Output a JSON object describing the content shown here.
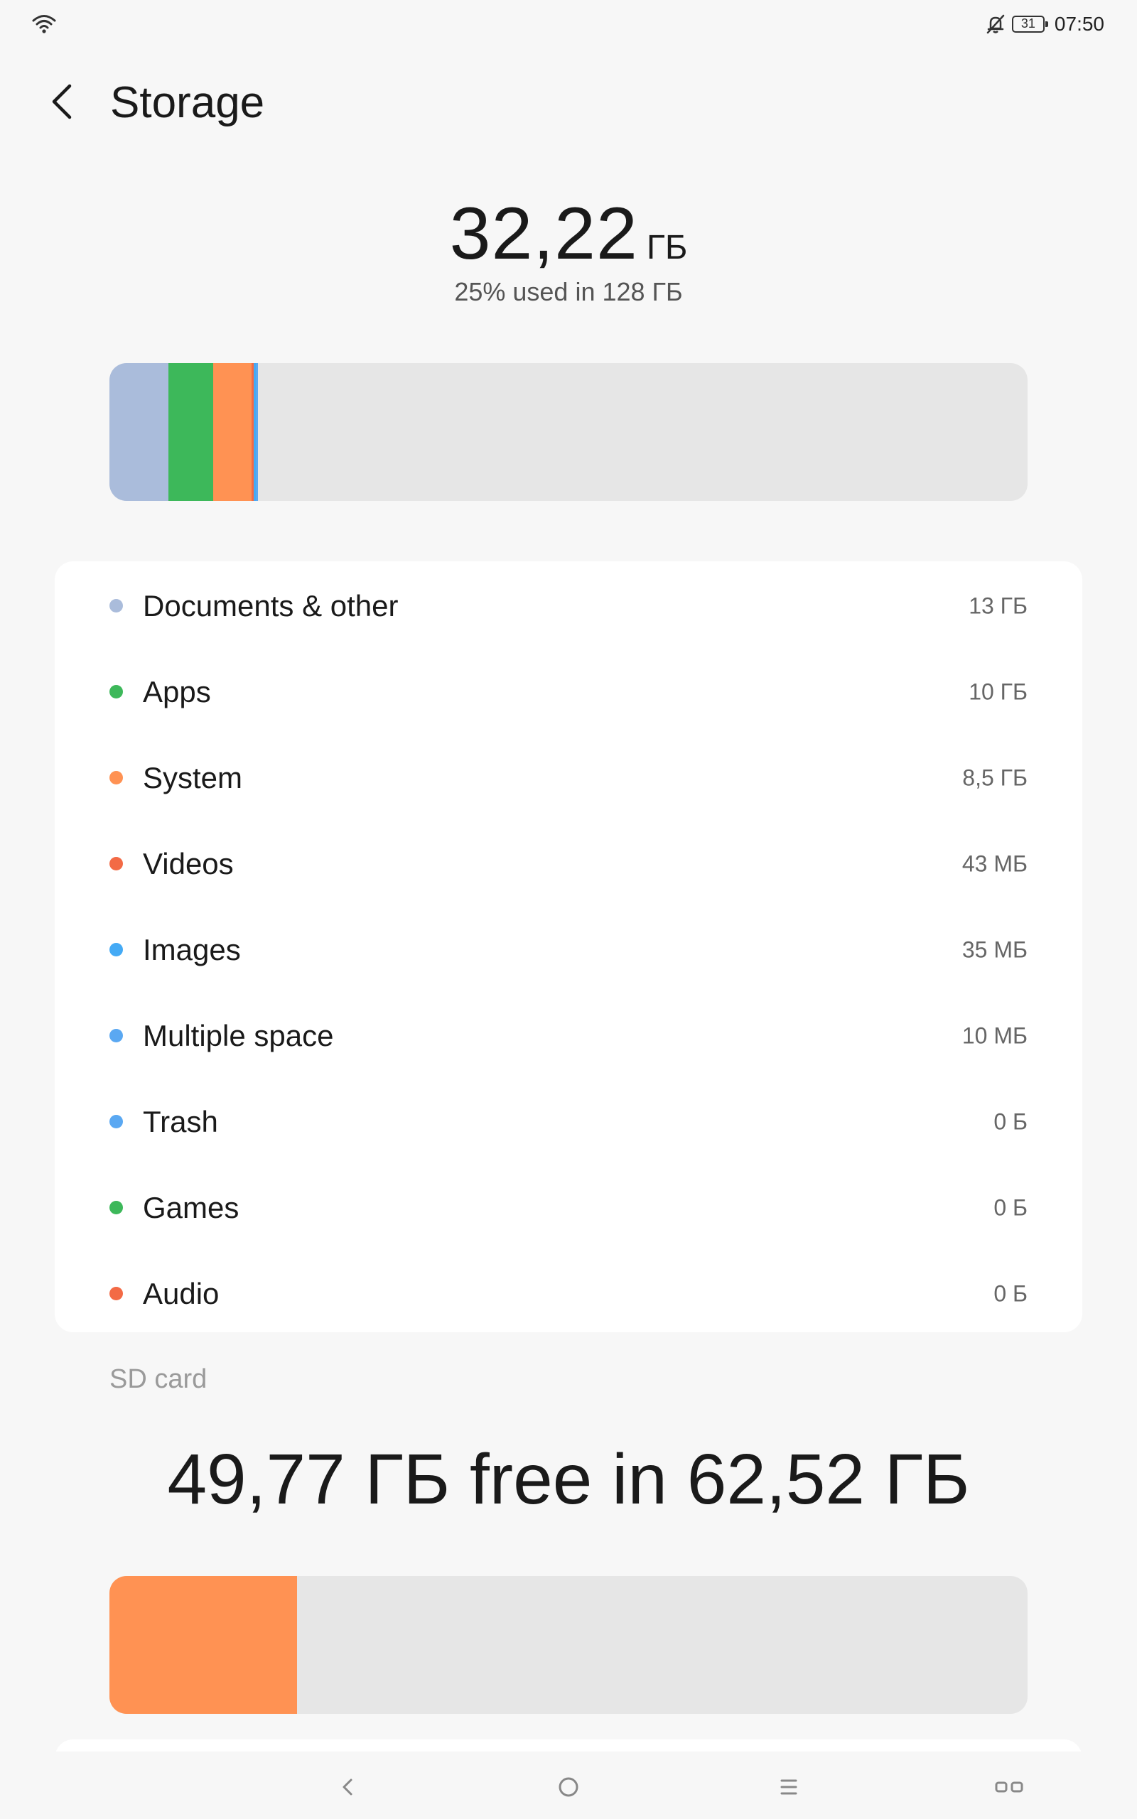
{
  "status_bar": {
    "battery_level": "31",
    "time": "07:50",
    "icons": [
      "wifi-icon",
      "bell-muted-icon",
      "battery-icon"
    ]
  },
  "header": {
    "title": "Storage",
    "back_icon": "chevron-left-icon"
  },
  "internal": {
    "used_value": "32,22",
    "used_unit": "ГБ",
    "subtitle": "25% used in 128 ГБ",
    "bar_segments": [
      {
        "name": "Documents & other",
        "fraction": 0.064,
        "color": "#aabcdb"
      },
      {
        "name": "Apps",
        "fraction": 0.049,
        "color": "#3db85a"
      },
      {
        "name": "System",
        "fraction": 0.042,
        "color": "#ff9253"
      },
      {
        "name": "Videos",
        "fraction": 0.0025,
        "color": "#f36a45"
      },
      {
        "name": "Images",
        "fraction": 0.002,
        "color": "#44aaf5"
      },
      {
        "name": "Multiple space",
        "fraction": 0.002,
        "color": "#5aa8f2"
      }
    ],
    "bar_track_color": "#e6e6e6"
  },
  "categories": [
    {
      "label": "Documents & other",
      "value": "13 ГБ",
      "color": "#aabcdb"
    },
    {
      "label": "Apps",
      "value": "10 ГБ",
      "color": "#3db85a"
    },
    {
      "label": "System",
      "value": "8,5 ГБ",
      "color": "#ff9253"
    },
    {
      "label": "Videos",
      "value": "43 МБ",
      "color": "#f36a45"
    },
    {
      "label": "Images",
      "value": "35 МБ",
      "color": "#44aaf5"
    },
    {
      "label": "Multiple space",
      "value": "10 МБ",
      "color": "#5aa8f2"
    },
    {
      "label": "Trash",
      "value": "0 Б",
      "color": "#5aa8f2"
    },
    {
      "label": "Games",
      "value": "0 Б",
      "color": "#3db85a"
    },
    {
      "label": "Audio",
      "value": "0 Б",
      "color": "#f36a45"
    }
  ],
  "sd_card": {
    "label": "SD card",
    "summary": "49,77 ГБ free in 62,52 ГБ",
    "used_fraction": 0.204,
    "used_color": "#ff9253"
  },
  "nav_bar": {
    "icons": [
      "back-icon",
      "home-icon",
      "menu-icon",
      "recents-icon"
    ]
  }
}
